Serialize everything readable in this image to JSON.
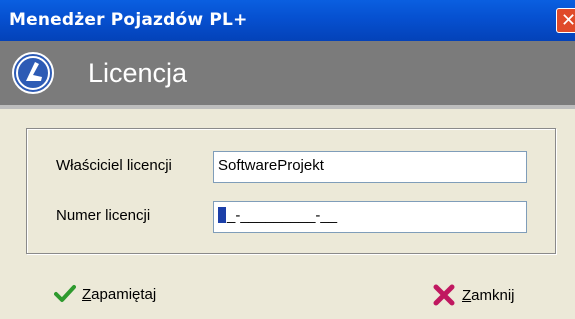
{
  "window": {
    "title": "Menedżer Pojazdów PL+",
    "close_glyph": "✕"
  },
  "header": {
    "title": "Licencja",
    "logo_icon": "pojazdy-logo-icon"
  },
  "form": {
    "owner_label": "Właściciel licencji",
    "owner_value": "SoftwareProjekt",
    "number_label": "Numer licencji",
    "number_value": "_-_________-__"
  },
  "buttons": {
    "save": {
      "mnemonic": "Z",
      "rest": "apamiętaj",
      "icon": "check-icon"
    },
    "close": {
      "mnemonic": "Z",
      "rest": "amknij",
      "icon": "x-icon"
    }
  },
  "colors": {
    "titlebar": "#0650D0",
    "header": "#7B7B7B",
    "dialog_bg": "#ECE9D8",
    "check": "#2E9A2E",
    "cross": "#C01860"
  }
}
